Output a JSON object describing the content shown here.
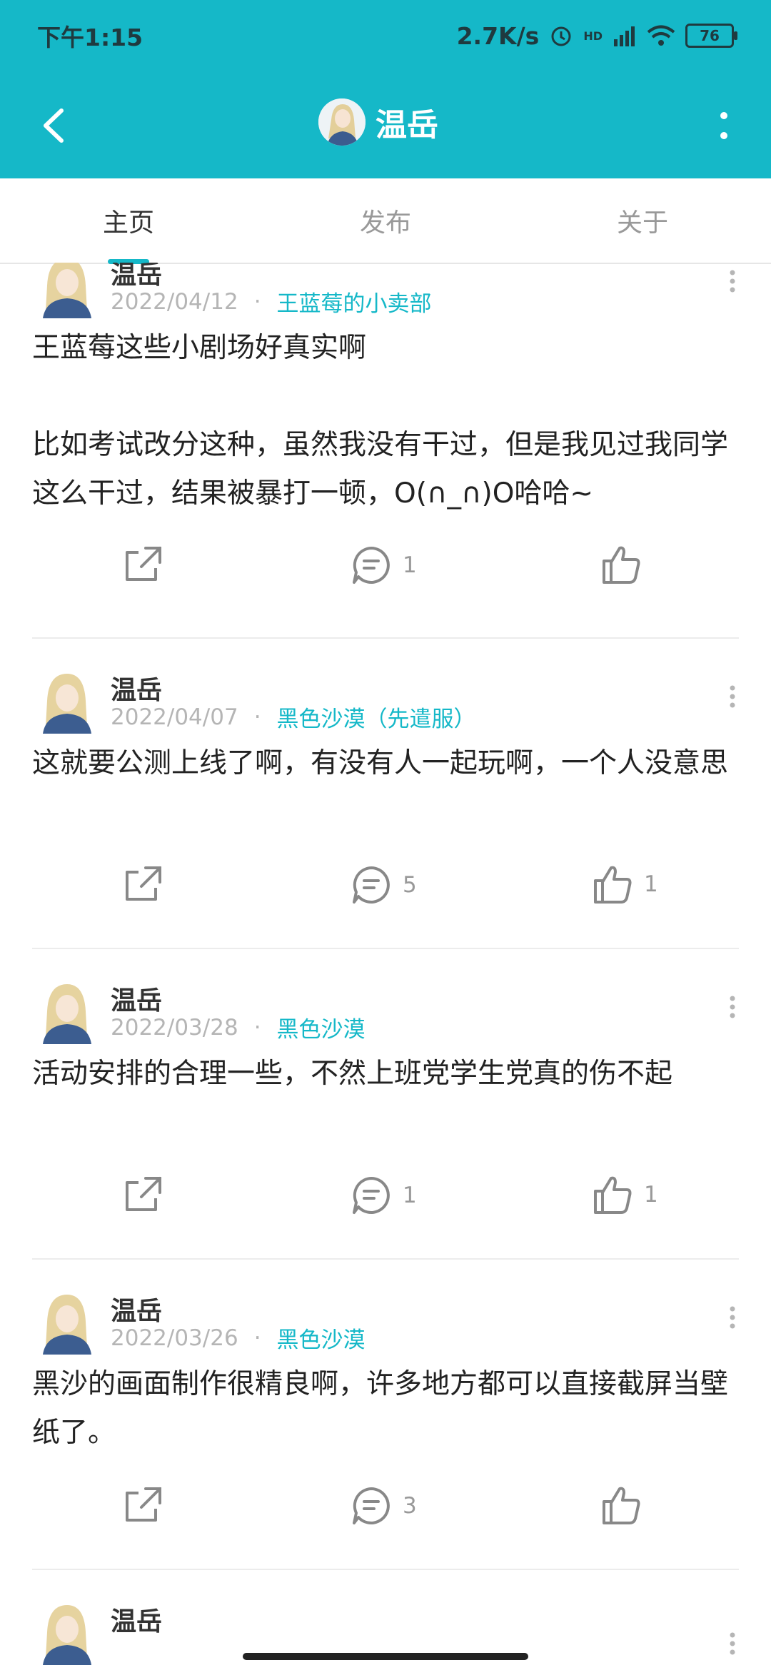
{
  "status_bar": {
    "time": "下午1:15",
    "net_speed": "2.7K/s",
    "hd": "HD",
    "battery": "76"
  },
  "header": {
    "title": "温岳"
  },
  "tabs": [
    {
      "label": "主页"
    },
    {
      "label": "发布"
    },
    {
      "label": "关于"
    }
  ],
  "posts": [
    {
      "author": "温岳",
      "date": "2022/04/12",
      "tag": "王蓝莓的小卖部",
      "content": "王蓝莓这些小剧场好真实啊\n\n比如考试改分这种，虽然我没有干过，但是我见过我同学这么干过，结果被暴打一顿，O(∩_∩)O哈哈~",
      "comments": "1",
      "likes": ""
    },
    {
      "author": "温岳",
      "date": "2022/04/07",
      "tag": "黑色沙漠（先遣服）",
      "content": "这就要公测上线了啊，有没有人一起玩啊，一个人没意思",
      "comments": "5",
      "likes": "1"
    },
    {
      "author": "温岳",
      "date": "2022/03/28",
      "tag": "黑色沙漠",
      "content": "活动安排的合理一些，不然上班党学生党真的伤不起",
      "comments": "1",
      "likes": "1"
    },
    {
      "author": "温岳",
      "date": "2022/03/26",
      "tag": "黑色沙漠",
      "content": "黑沙的画面制作很精良啊，许多地方都可以直接截屏当壁纸了。",
      "comments": "3",
      "likes": ""
    },
    {
      "author": "温岳"
    }
  ],
  "icons": {
    "back": "chevron-left-icon",
    "more": "more-vertical-icon",
    "share": "share-icon",
    "comment": "comment-icon",
    "like": "thumbs-up-icon"
  },
  "colors": {
    "accent": "#15b8c8"
  }
}
